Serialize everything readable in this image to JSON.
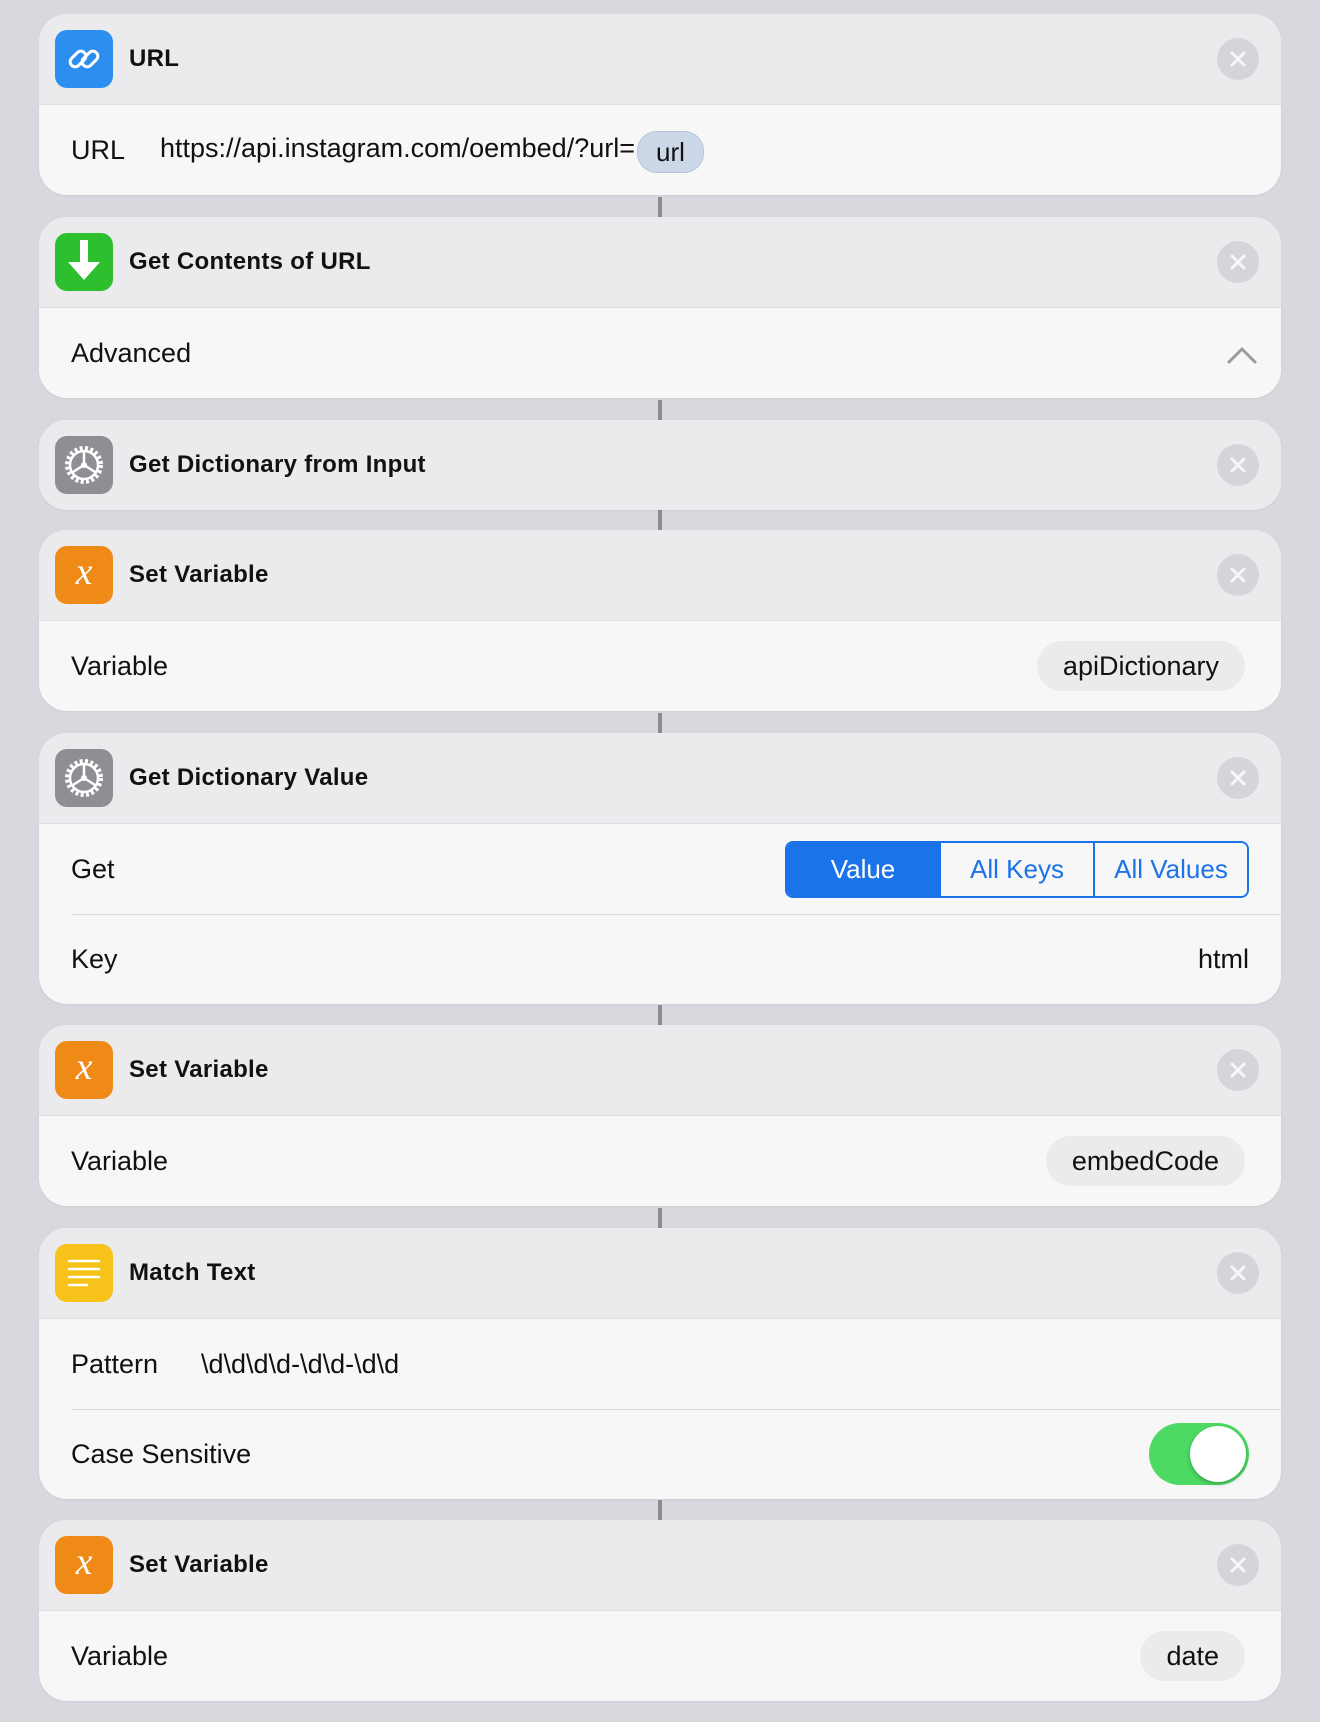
{
  "colors": {
    "url_icon": "#2c8ff0",
    "download_icon": "#2dbf2d",
    "gear_icon": "#8e8e93",
    "variable_icon": "#f08a17",
    "text_icon": "#f7c21a",
    "accent": "#1a73e8",
    "toggle_on": "#4cd964"
  },
  "actions": {
    "url": {
      "title": "URL",
      "icon": "link-icon",
      "label": "URL",
      "value": "https://api.instagram.com/oembed/?url=",
      "token": "url"
    },
    "get_contents": {
      "title": "Get Contents of URL",
      "icon": "download-arrow-icon",
      "advanced_label": "Advanced"
    },
    "get_dictionary": {
      "title": "Get Dictionary from Input",
      "icon": "gear-icon"
    },
    "set_variable_1": {
      "title": "Set Variable",
      "icon": "variable-x-icon",
      "label": "Variable",
      "value": "apiDictionary"
    },
    "get_dictionary_value": {
      "title": "Get Dictionary Value",
      "icon": "gear-icon",
      "get_label": "Get",
      "segments": [
        "Value",
        "All Keys",
        "All Values"
      ],
      "selected_segment": "Value",
      "key_label": "Key",
      "key_value": "html"
    },
    "set_variable_2": {
      "title": "Set Variable",
      "icon": "variable-x-icon",
      "label": "Variable",
      "value": "embedCode"
    },
    "match_text": {
      "title": "Match Text",
      "icon": "text-lines-icon",
      "pattern_label": "Pattern",
      "pattern_value": "\\d\\d\\d\\d-\\d\\d-\\d\\d",
      "case_label": "Case Sensitive",
      "case_sensitive": true
    },
    "set_variable_3": {
      "title": "Set Variable",
      "icon": "variable-x-icon",
      "label": "Variable",
      "value": "date"
    }
  }
}
